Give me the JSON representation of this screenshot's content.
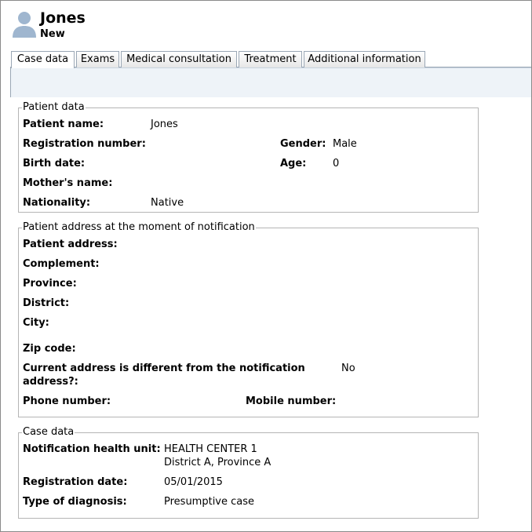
{
  "header": {
    "patient_name": "Jones",
    "status": "New",
    "avatar_icon": "user-avatar-icon"
  },
  "tabs": [
    {
      "label": "Case data",
      "active": true
    },
    {
      "label": "Exams",
      "active": false
    },
    {
      "label": "Medical consultation",
      "active": false
    },
    {
      "label": "Treatment",
      "active": false
    },
    {
      "label": "Additional information",
      "active": false
    }
  ],
  "patient_data": {
    "legend": "Patient data",
    "name_label": "Patient name:",
    "name_value": "Jones",
    "registration_number_label": "Registration number:",
    "gender_label": "Gender:",
    "gender_value": "Male",
    "birth_date_label": "Birth date:",
    "age_label": "Age:",
    "age_value": "0",
    "mother_name_label": "Mother's name:",
    "nationality_label": "Nationality:",
    "nationality_value": "Native"
  },
  "patient_address": {
    "legend": "Patient address at the moment of notification",
    "address_label": "Patient address:",
    "complement_label": "Complement:",
    "province_label": "Province:",
    "district_label": "District:",
    "city_label": "City:",
    "zip_label": "Zip code:",
    "different_label_line1": "Current address is different from the notification",
    "different_label_line2": "address?:",
    "different_value": "No",
    "phone_label": "Phone number:",
    "mobile_label": "Mobile number:"
  },
  "case_data": {
    "legend": "Case data",
    "unit_label": "Notification health unit:",
    "unit_value_line1": "HEALTH CENTER 1",
    "unit_value_line2": "District A, Province A",
    "registration_date_label": "Registration date:",
    "registration_date_value": "05/01/2015",
    "diagnosis_label": "Type of diagnosis:",
    "diagnosis_value": "Presumptive case"
  },
  "colors": {
    "avatar": "#9fb6cf",
    "tab_border": "#9aa7b5",
    "panel_strip": "#eef3f8",
    "group_border": "#b5b5b5"
  }
}
